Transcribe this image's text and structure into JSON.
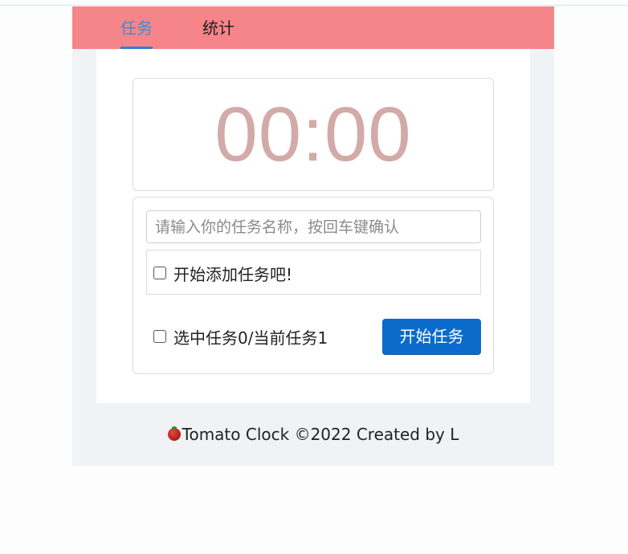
{
  "tabs": [
    {
      "label": "任务",
      "active": true
    },
    {
      "label": "统计",
      "active": false
    }
  ],
  "timer": {
    "display": "00:00"
  },
  "task_input": {
    "placeholder": "请输入你的任务名称，按回车键确认",
    "value": ""
  },
  "task_list": {
    "items": [
      {
        "label": "开始添加任务吧!",
        "checked": false
      }
    ]
  },
  "summary": {
    "label": "选中任务0/当前任务1",
    "checked": false
  },
  "start_button": {
    "label": "开始任务"
  },
  "footer": {
    "text": "Tomato Clock ©2022 Created by L",
    "icon": "tomato-icon"
  },
  "colors": {
    "header": "#f6858a",
    "active_tab": "#3d8cd6",
    "timer_text": "#d2aaa8",
    "button": "#0b6bcb"
  }
}
